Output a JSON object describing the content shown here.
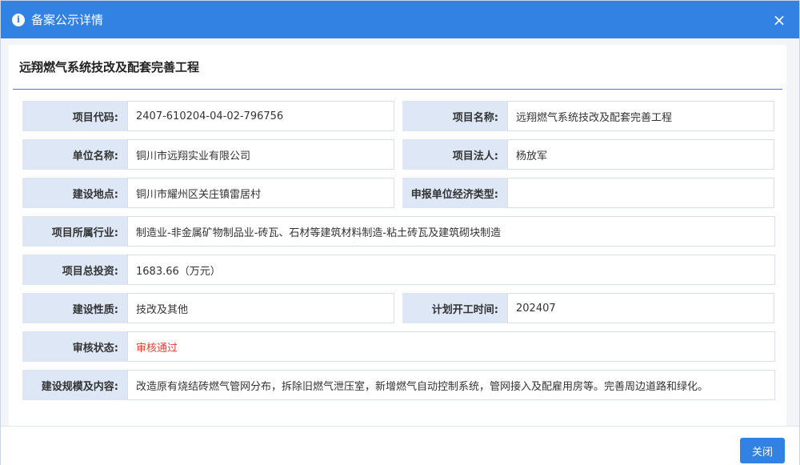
{
  "dialog": {
    "title": "备案公示详情",
    "close_label": "×",
    "project_title": "远翔燃气系统技改及配套完善工程",
    "footer_close_label": "关闭"
  },
  "fields": {
    "project_code_label": "项目代码:",
    "project_code_value": "2407-610204-04-02-796756",
    "project_name_label": "项目名称:",
    "project_name_value": "远翔燃气系统技改及配套完善工程",
    "unit_name_label": "单位名称:",
    "unit_name_value": "铜川市远翔实业有限公司",
    "legal_person_label": "项目法人:",
    "legal_person_value": "杨放军",
    "location_label": "建设地点:",
    "location_value": "铜川市耀州区关庄镇雷居村",
    "economic_type_label": "申报单位经济类型:",
    "economic_type_value": "",
    "industry_label": "项目所属行业:",
    "industry_value": "制造业-非金属矿物制品业-砖瓦、石材等建筑材料制造-粘土砖瓦及建筑砌块制造",
    "investment_label": "项目总投资:",
    "investment_value": "1683.66（万元）",
    "nature_label": "建设性质:",
    "nature_value": "技改及其他",
    "start_time_label": "计划开工时间:",
    "start_time_value": "202407",
    "status_label": "审核状态:",
    "status_value": "审核通过",
    "scope_label": "建设规模及内容:",
    "scope_value": "改造原有烧结砖燃气管网分布，拆除旧燃气泄压室，新增燃气自动控制系统，管网接入及配雇用房等。完善周边道路和绿化。"
  },
  "colors": {
    "header_blue": "#3182e3",
    "label_bg": "#dde7f5",
    "status_red": "#e2402f"
  }
}
